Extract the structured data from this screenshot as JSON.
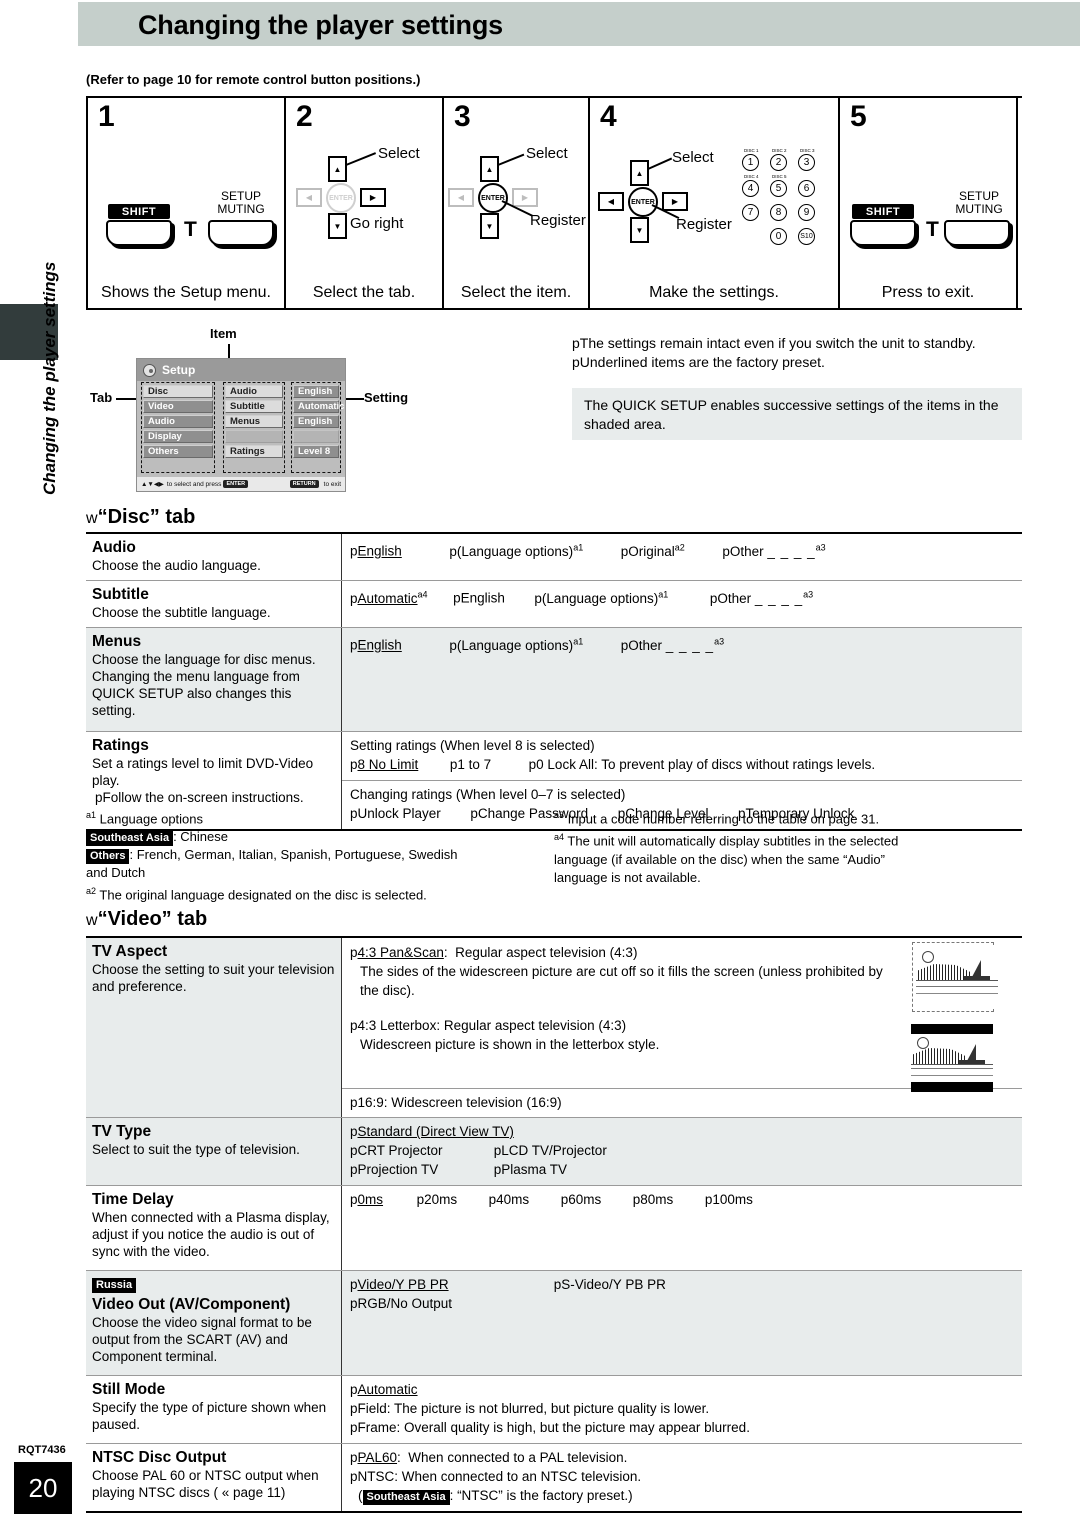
{
  "header": {
    "title": "Changing the player settings"
  },
  "side": {
    "vertical_label": "Changing the player settings"
  },
  "footer": {
    "rqt_code": "RQT7436",
    "page_number": "20"
  },
  "refer_note": "(Refer to page 10 for remote control button positions.)",
  "steps": [
    {
      "num": "1",
      "caption": "Shows the Setup menu.",
      "buttons": {
        "shift": "SHIFT",
        "plus": "T",
        "setup_line1": "SETUP",
        "setup_line2": "MUTING"
      }
    },
    {
      "num": "2",
      "caption": "Select the tab.",
      "callouts": {
        "select": "Select",
        "go_right": "Go right"
      },
      "enter_label": "ENTER"
    },
    {
      "num": "3",
      "caption": "Select the item.",
      "callouts": {
        "select": "Select",
        "register": "Register"
      },
      "enter_label": "ENTER"
    },
    {
      "num": "4",
      "caption": "Make the settings.",
      "callouts": {
        "select": "Select",
        "register": "Register"
      },
      "enter_label": "ENTER",
      "numpad": {
        "keys": [
          "1",
          "2",
          "3",
          "4",
          "5",
          "6",
          "7",
          "8",
          "9",
          "0",
          "S10"
        ],
        "disc_labels": [
          "DISC 1",
          "DISC 2",
          "DISC 3",
          "DISC 4",
          "DISC 5"
        ]
      }
    },
    {
      "num": "5",
      "caption": "Press to exit.",
      "buttons": {
        "shift": "SHIFT",
        "plus": "T",
        "setup_line1": "SETUP",
        "setup_line2": "MUTING"
      }
    }
  ],
  "osd": {
    "labels": {
      "tab": "Tab",
      "item": "Item",
      "setting": "Setting"
    },
    "title": "Setup",
    "tabs": [
      "Disc",
      "Video",
      "Audio",
      "Display",
      "Others"
    ],
    "items": [
      "Audio",
      "Subtitle",
      "Menus",
      "",
      "Ratings"
    ],
    "settings": [
      "English",
      "Automatic",
      "English",
      "",
      "Level 8"
    ],
    "footer_left_prefix": "to select and press",
    "footer_enter_chip": "ENTER",
    "footer_right_chip": "RETURN",
    "footer_right_suffix": "to exit"
  },
  "notes": {
    "bullets": [
      "pThe settings remain intact even if you switch the unit to standby.",
      "pUnderlined items are the factory preset."
    ],
    "quick_setup": "The QUICK SETUP enables successive settings of the items in the shaded area."
  },
  "disc_tab": {
    "heading_w": "w",
    "heading": "“Disc” tab",
    "rows": [
      {
        "name": "Audio",
        "desc": "Choose the audio language.",
        "shaded": false,
        "options": [
          {
            "text": "pEnglish",
            "underline": "English"
          },
          {
            "text": "p(Language options)",
            "sup": "a1"
          },
          {
            "text": "pOriginal",
            "sup": "a2"
          },
          {
            "text": "pOther _ _ _ _",
            "sup": "a3"
          }
        ]
      },
      {
        "name": "Subtitle",
        "desc": "Choose the subtitle language.",
        "shaded": false,
        "options": [
          {
            "text": "pAutomatic",
            "underline": "Automatic",
            "sup": "a4"
          },
          {
            "text": "pEnglish"
          },
          {
            "text": "p(Language options)",
            "sup": "a1"
          },
          {
            "text": "pOther _ _ _ _",
            "sup": "a3"
          }
        ]
      },
      {
        "name": "Menus",
        "desc": "Choose the language for disc menus. Changing the menu language from QUICK SETUP also changes this setting.",
        "shaded": true,
        "options": [
          {
            "text": "pEnglish",
            "underline": "English"
          },
          {
            "text": "p(Language options)",
            "sup": "a1"
          },
          {
            "text": "pOther _ _ _ _",
            "sup": "a3"
          }
        ]
      }
    ],
    "ratings": {
      "name": "Ratings",
      "desc1": "Set a ratings level to limit DVD-Video play.",
      "desc2": "pFollow the on-screen instructions.",
      "block1_title": "Setting ratings (When level 8 is selected)",
      "block1_options": [
        "p8 No Limit",
        "p1 to 7",
        "p0 Lock All: To prevent play of discs without ratings levels."
      ],
      "block2_title": "Changing ratings (When level 0–7 is selected)",
      "block2_options": [
        "pUnlock Player",
        "pChange Password",
        "pChange Level",
        "pTemporary Unlock"
      ]
    },
    "footnotes_left": [
      "a1 Language options",
      "Southeast Asia",
      ": Chinese",
      "Others",
      ": French, German, Italian, Spanish, Portuguese, Swedish",
      "and Dutch",
      "a2 The original language designated on the disc is selected."
    ],
    "footnotes_right": [
      "a3 Input a code number referring to the table on page 31.",
      "a4 The unit will automatically display subtitles in the selected",
      "language (if available on the disc) when the same “Audio”",
      "language is not available."
    ]
  },
  "video_tab": {
    "heading_w": "w",
    "heading": "“Video” tab",
    "tv_aspect": {
      "name": "TV Aspect",
      "desc": "Choose the setting to suit your television and preference.",
      "option1_title": "p4:3 Pan&Scan:  Regular aspect television (4:3)",
      "option1_underline": "4:3 Pan&Scan",
      "option1_body": "The sides of the widescreen picture are cut off so it fills the screen (unless prohibited by the disc).",
      "option2_title": "p4:3 Letterbox:  Regular aspect television (4:3)",
      "option2_body": "Widescreen picture is shown in the letterbox style.",
      "option3_title": "p16:9:  Widescreen television (16:9)"
    },
    "tv_type": {
      "name": "TV Type",
      "desc": "Select to suit the type of television.",
      "options": [
        "pStandard (Direct View TV)",
        "pCRT Projector",
        "pLCD TV/Projector",
        "pProjection TV",
        "pPlasma TV"
      ],
      "underline": "Standard (Direct View TV)"
    },
    "time_delay": {
      "name": "Time Delay",
      "desc": "When connected with a Plasma display, adjust if you notice the audio is out of sync with the video.",
      "options": [
        "p0ms",
        "p20ms",
        "p40ms",
        "p60ms",
        "p80ms",
        "p100ms"
      ],
      "underline": "0ms"
    },
    "video_out": {
      "chip": "Russia",
      "name": "Video Out (AV/Component)",
      "desc": "Choose the video signal format to be output from the SCART (AV) and Component terminal.",
      "options": [
        "pVideo/Y PB PR",
        "pS-Video/Y PB PR",
        "pRGB/No Output"
      ],
      "underline": "Video/Y PB PR"
    },
    "still_mode": {
      "name": "Still Mode",
      "desc": "Specify the type of picture shown when paused.",
      "options": [
        "pAutomatic",
        "pField:   The picture is not blurred, but picture quality is lower.",
        "pFrame:  Overall quality is high, but the picture may appear blurred."
      ],
      "underline": "Automatic"
    },
    "ntsc_disc_output": {
      "name": "NTSC Disc Output",
      "desc": "Choose PAL 60 or NTSC output when playing NTSC discs ( « page 11)",
      "options": [
        "pPAL60:  When connected to a PAL television.",
        "pNTSC:  When connected to an NTSC television."
      ],
      "underline": "PAL60",
      "note_prefix": "(",
      "note_chip": "Southeast Asia",
      "note_suffix": ":  “NTSC” is the factory preset.)"
    }
  }
}
